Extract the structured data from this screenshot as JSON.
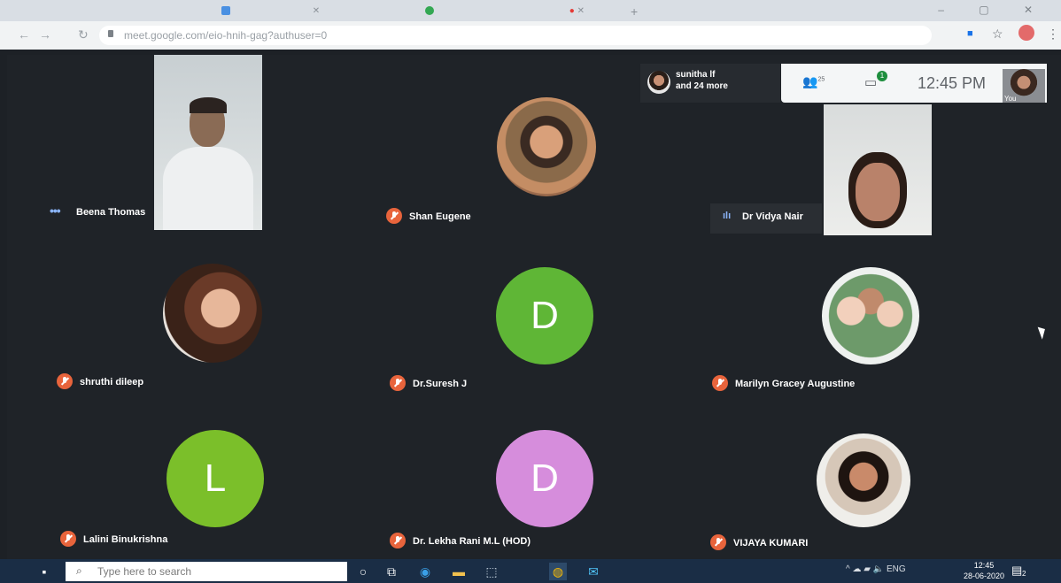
{
  "browser": {
    "url": "meet.google.com/eio-hnih-gag?authuser=0",
    "tabs": [
      "",
      ""
    ],
    "window_controls": "–  ▢  ✕"
  },
  "meet": {
    "participants_overlay": {
      "line1": "sunitha lf",
      "line2": "and 24 more"
    },
    "people_count": "25",
    "chat_badge": "1",
    "clock": "12:45 PM",
    "self_label": "You",
    "tiles": [
      {
        "name": "Beena Thomas",
        "indicator": "dots"
      },
      {
        "name": "Shan Eugene",
        "indicator": "muted"
      },
      {
        "name": "Dr Vidya Nair",
        "indicator": "speaking"
      },
      {
        "name": "shruthi dileep",
        "indicator": "muted"
      },
      {
        "name": "Dr.Suresh J",
        "indicator": "muted",
        "letter": "D"
      },
      {
        "name": "Marilyn Gracey Augustine",
        "indicator": "muted"
      },
      {
        "name": "Lalini Binukrishna",
        "indicator": "muted",
        "letter": "L"
      },
      {
        "name": "Dr. Lekha Rani M.L (HOD)",
        "indicator": "muted",
        "letter": "D"
      },
      {
        "name": "VIJAYA KUMARI",
        "indicator": "muted"
      }
    ]
  },
  "taskbar": {
    "search_placeholder": "Type here to search",
    "tray_lang": "ENG",
    "time": "12:45",
    "date": "28-06-2020",
    "notification_count": "2"
  },
  "colors": {
    "muted_red": "#e8643c",
    "green_avatar": "#5fb636",
    "pink_avatar": "#d68ddc",
    "stage_bg": "#1f2328"
  }
}
